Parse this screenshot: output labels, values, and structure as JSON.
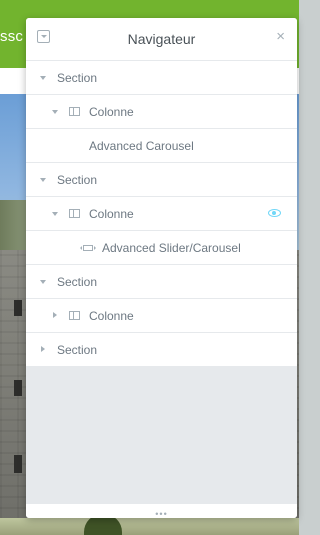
{
  "background": {
    "header_text_fragment": "ssc"
  },
  "navigator": {
    "title": "Navigateur",
    "close_glyph": "×",
    "collapse_icon": "caret-square-down-icon",
    "footer_handle": "•••",
    "items": [
      {
        "label": "Section",
        "type": "section",
        "expanded": true,
        "indent": 0
      },
      {
        "label": "Colonne",
        "type": "column",
        "expanded": true,
        "indent": 1
      },
      {
        "label": "Advanced Carousel",
        "type": "widget",
        "indent": 2
      },
      {
        "label": "Section",
        "type": "section",
        "expanded": true,
        "indent": 0
      },
      {
        "label": "Colonne",
        "type": "column",
        "expanded": true,
        "indent": 1,
        "visibility_icon": "eye-icon"
      },
      {
        "label": "Advanced Slider/Carousel",
        "type": "widget",
        "indent": 2,
        "icon": "slider-icon"
      },
      {
        "label": "Section",
        "type": "section",
        "expanded": true,
        "indent": 0
      },
      {
        "label": "Colonne",
        "type": "column",
        "expanded": false,
        "indent": 1
      },
      {
        "label": "Section",
        "type": "section",
        "expanded": false,
        "indent": 0
      }
    ]
  },
  "colors": {
    "accent_eye": "#71d7f7",
    "text": "#6d7882",
    "site_green": "#72b42e"
  }
}
